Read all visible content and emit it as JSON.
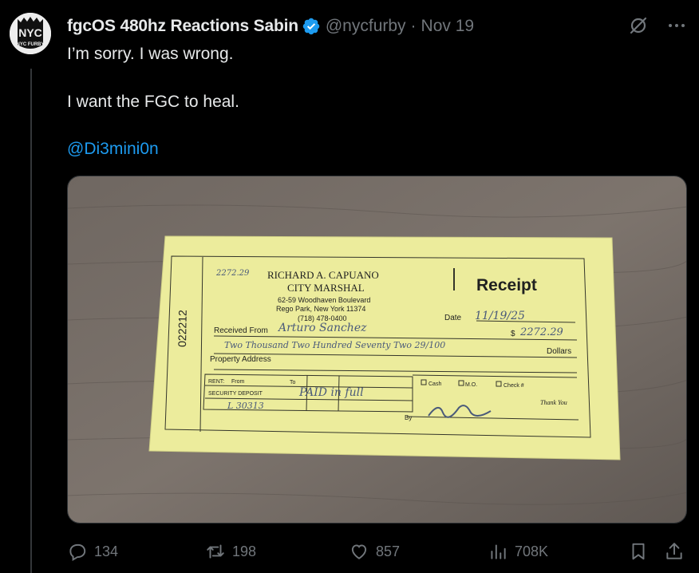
{
  "tweet": {
    "display_name": "fgcOS 480hz Reactions Sabin",
    "handle": "@nycfurby",
    "separator": "·",
    "date": "Nov 19",
    "lines": [
      "I’m sorry. I was wrong.",
      "I want the FGC to heal."
    ],
    "mention": "@Di3mini0n",
    "avatar_text": "NYC FURBY",
    "verified": true
  },
  "receipt": {
    "number": "022212",
    "name": "RICHARD A. CAPUANO",
    "title": "CITY MARSHAL",
    "address_line1": "62-59 Woodhaven Boulevard",
    "address_line2": "Rego Park, New York 11374",
    "phone": "(718) 478-0400",
    "heading": "Receipt",
    "date_label": "Date",
    "date_value": "11/19/25",
    "received_from_label": "Received From",
    "received_from_value": "Arturo Sanchez",
    "amount_prefix": "$",
    "amount_value": "2272.29",
    "amount_words": "Two Thousand Two Hundred Seventy Two 29/100",
    "dollars_label": "Dollars",
    "property_label": "Property Address",
    "rent_label": "RENT:",
    "from_label": "From",
    "to_label": "To",
    "security_label": "SECURITY DEPOSIT",
    "handwritten_note": "PAID in full",
    "handwritten_ref": "L 30313",
    "handwritten_corner": "2272.29",
    "cash_label": "Cash",
    "mo_label": "M.O.",
    "check_label": "Check #",
    "thank_you": "Thank You",
    "by_label": "By"
  },
  "actions": {
    "replies": "134",
    "reposts": "198",
    "likes": "857",
    "views": "708K"
  },
  "colors": {
    "background": "#000000",
    "text": "#e7e9ea",
    "muted": "#71767b",
    "accent": "#1d9bf0"
  },
  "icons": [
    "grok-icon",
    "more-icon",
    "verified-badge-icon",
    "reply-icon",
    "repost-icon",
    "like-icon",
    "views-icon",
    "bookmark-icon",
    "share-icon"
  ]
}
